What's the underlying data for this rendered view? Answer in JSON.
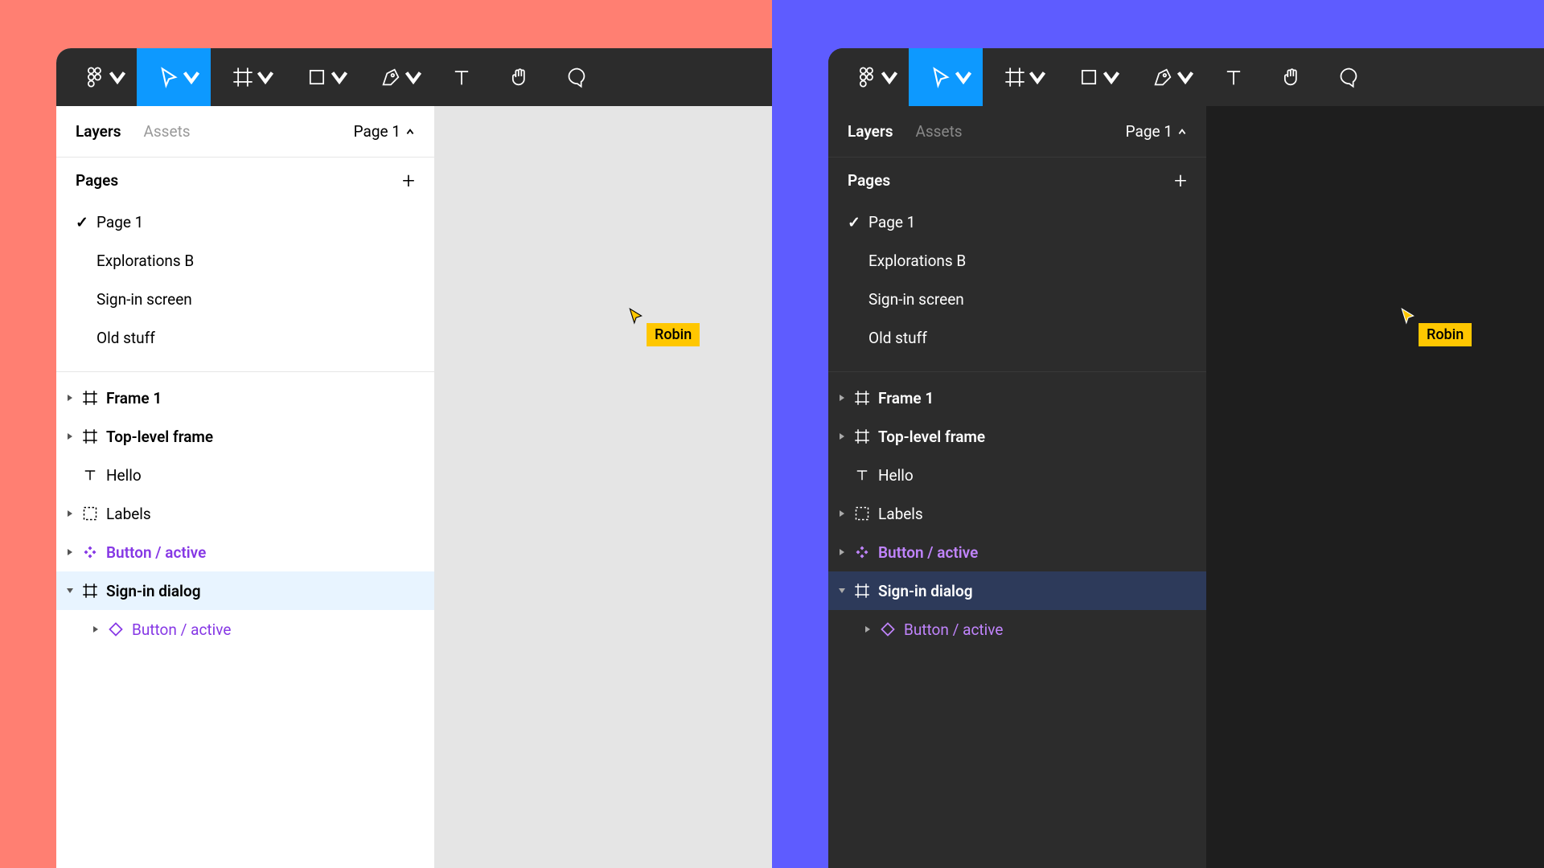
{
  "panels": {
    "layers_tab": "Layers",
    "assets_tab": "Assets",
    "page_selector": "Page 1",
    "pages_label": "Pages"
  },
  "pages": [
    {
      "name": "Page 1",
      "current": true
    },
    {
      "name": "Explorations B",
      "current": false
    },
    {
      "name": "Sign-in screen",
      "current": false
    },
    {
      "name": "Old stuff",
      "current": false
    }
  ],
  "layers": [
    {
      "name": "Frame 1",
      "icon": "frame",
      "expandable": true,
      "bold": true
    },
    {
      "name": "Top-level frame",
      "icon": "frame",
      "expandable": true,
      "bold": true
    },
    {
      "name": "Hello",
      "icon": "text",
      "expandable": false,
      "bold": false
    },
    {
      "name": "Labels",
      "icon": "group",
      "expandable": true,
      "bold": false
    },
    {
      "name": "Button / active",
      "icon": "component",
      "expandable": true,
      "bold": true,
      "purple": true
    },
    {
      "name": "Sign-in dialog",
      "icon": "frame",
      "expandable": true,
      "expanded": true,
      "bold": true,
      "selected": true
    },
    {
      "name": "Button / active",
      "icon": "instance",
      "expandable": true,
      "bold": false,
      "purple": true,
      "nested": true
    }
  ],
  "collaborator": {
    "name": "Robin",
    "badge_color": "#ffc700"
  },
  "toolbar": {
    "tools": [
      "figma-menu",
      "move",
      "frame",
      "rectangle",
      "pen",
      "text",
      "hand",
      "comment"
    ],
    "active": "move"
  },
  "colors": {
    "left_bg": "#FF7F72",
    "right_bg": "#5E5CFF",
    "accent": "#0d99ff",
    "component": "#8638E5"
  }
}
